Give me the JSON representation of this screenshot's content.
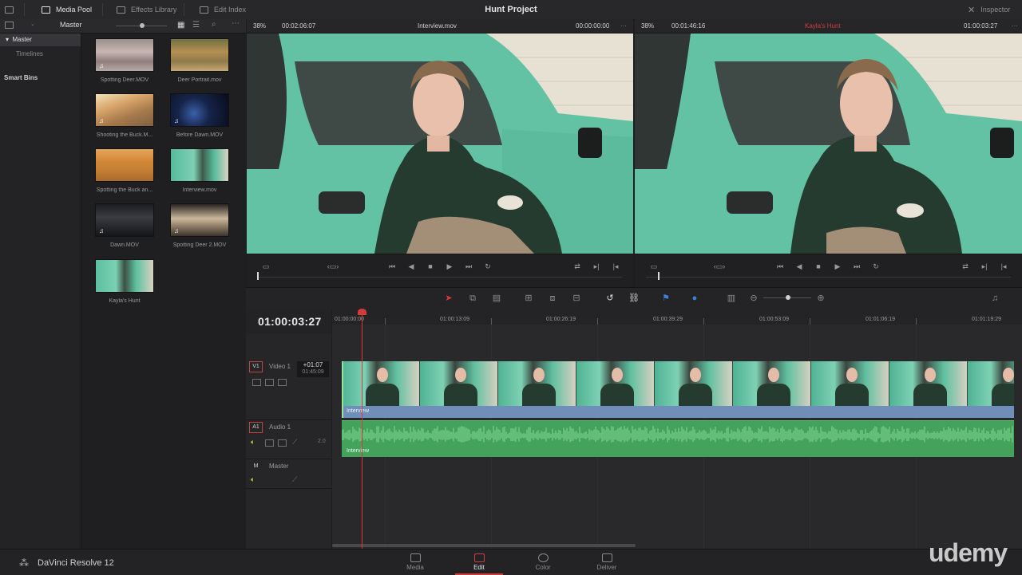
{
  "app": {
    "project_title": "Hunt Project",
    "product_name": "DaVinci Resolve 12",
    "watermark": "udemy"
  },
  "topbar": {
    "media_pool": "Media Pool",
    "effects_library": "Effects Library",
    "edit_index": "Edit Index",
    "inspector": "Inspector"
  },
  "bin_selector": "Master",
  "sidebar": {
    "master": "Master",
    "timelines": "Timelines",
    "smart_bins": "Smart Bins"
  },
  "clips": [
    {
      "name": "Spotting Deer.MOV",
      "audio": true
    },
    {
      "name": "Deer Portrait.mov",
      "audio": false
    },
    {
      "name": "Shooting the Buck.M...",
      "audio": true
    },
    {
      "name": "Before Dawn.MOV",
      "audio": true
    },
    {
      "name": "Spotting the Buck an...",
      "audio": false
    },
    {
      "name": "Interview.mov",
      "audio": false
    },
    {
      "name": "Dawn.MOV",
      "audio": true
    },
    {
      "name": "Spotting Deer 2.MOV",
      "audio": true
    },
    {
      "name": "Kayla's Hunt",
      "audio": false
    }
  ],
  "source_viewer": {
    "zoom": "38%",
    "duration": "00:02:06:07",
    "clip_name": "Interview.mov",
    "timecode": "00:00:00:00",
    "playhead_fraction": 0.0
  },
  "timeline_viewer": {
    "zoom": "38%",
    "duration": "00:01:46:16",
    "timeline_name": "Kayla's Hunt",
    "timecode": "01:00:03:27",
    "playhead_fraction": 0.0
  },
  "timeline": {
    "current_timecode": "01:00:03:27",
    "ruler_labels": [
      "01:00:00:00",
      "01:00:13:09",
      "01:00:26:19",
      "01:00:39:29",
      "01:00:53:09",
      "01:01:06:19",
      "01:01:19:29"
    ],
    "v1": {
      "badge": "V1",
      "name": "Video 1",
      "clip_label": "Interview",
      "trim_offset": "+01:07",
      "trim_duration": "01:45:09"
    },
    "a1": {
      "badge": "A1",
      "name": "Audio 1",
      "clip_label": "Interview",
      "level": "2.0"
    },
    "master": {
      "badge": "M",
      "name": "Master"
    }
  },
  "pages": [
    {
      "label": "Media"
    },
    {
      "label": "Edit"
    },
    {
      "label": "Color"
    },
    {
      "label": "Deliver"
    }
  ],
  "colors": {
    "accent_red": "#d23b3b",
    "video_clip_bar": "#6f8fb8",
    "audio_clip": "#43a35a",
    "truck_green": "#63c2a3"
  }
}
